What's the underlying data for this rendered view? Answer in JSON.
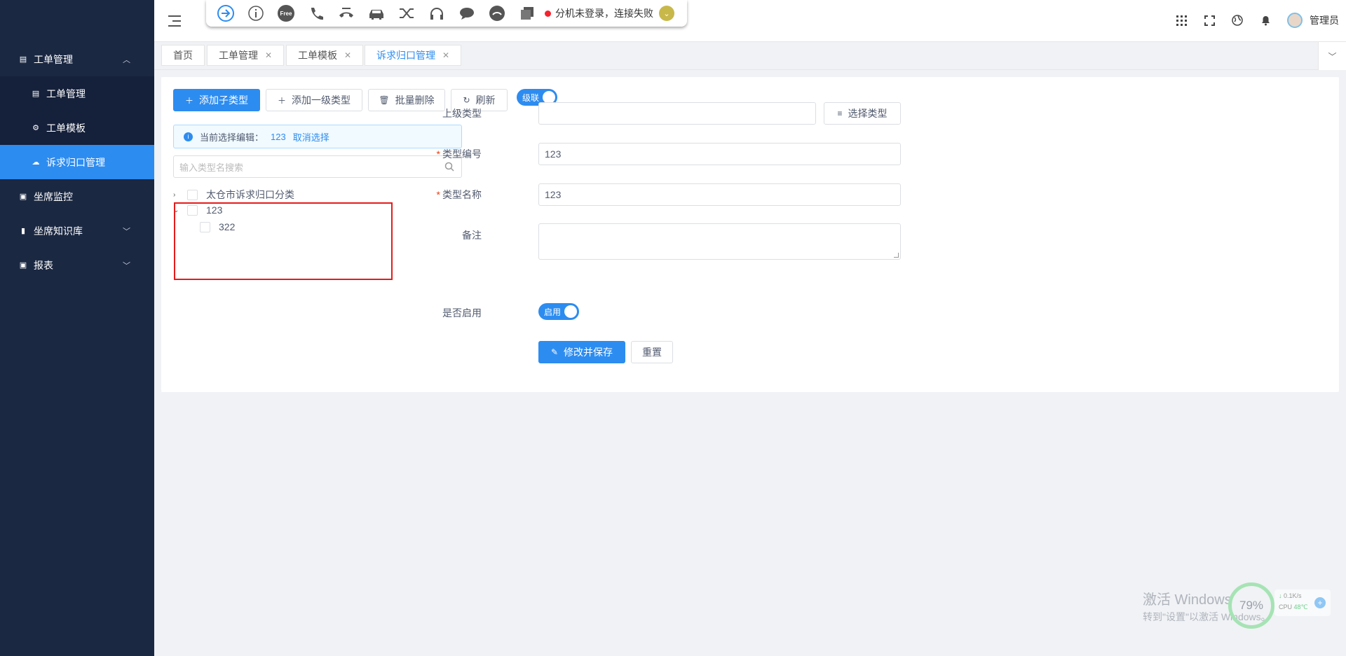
{
  "sidebar": {
    "items": [
      {
        "label": "工单管理",
        "icon": "document-icon",
        "expanded": true
      },
      {
        "label": "工单管理",
        "icon": "document-icon"
      },
      {
        "label": "工单模板",
        "icon": "gear-icon"
      },
      {
        "label": "诉求归口管理",
        "icon": "cloud-icon",
        "active": true
      },
      {
        "label": "坐席监控",
        "icon": "chart-icon"
      },
      {
        "label": "坐席知识库",
        "icon": "book-icon"
      },
      {
        "label": "报表",
        "icon": "chart-icon"
      }
    ]
  },
  "phonebar": {
    "icons": [
      "sign-in-icon",
      "info-icon",
      "free-icon",
      "phone-icon",
      "hangup-icon",
      "car-icon",
      "transfer-icon",
      "headset-icon",
      "chat-icon",
      "hold-icon",
      "copy-icon"
    ],
    "free_label": "Free",
    "status": "分机未登录，连接失败"
  },
  "header": {
    "username": "管理员"
  },
  "tabs": [
    {
      "label": "首页",
      "closable": false
    },
    {
      "label": "工单管理",
      "closable": true
    },
    {
      "label": "工单模板",
      "closable": true
    },
    {
      "label": "诉求归口管理",
      "closable": true,
      "active": true
    }
  ],
  "toolbar": {
    "add_child": "添加子类型",
    "add_top": "添加一级类型",
    "batch_delete": "批量删除",
    "refresh": "刷新",
    "cascade": "级联"
  },
  "alert": {
    "prefix": "当前选择编辑：",
    "selected": "123",
    "cancel": "取消选择"
  },
  "search": {
    "placeholder": "输入类型名搜索"
  },
  "tree": {
    "nodes": [
      {
        "label": "太仓市诉求归口分类",
        "expanded": false
      },
      {
        "label": "123",
        "expanded": true
      },
      {
        "label": "322",
        "child": true
      }
    ]
  },
  "form": {
    "parent_label": "上级类型",
    "parent_value": "",
    "select_type": "选择类型",
    "code_label": "类型编号",
    "code_value": "123",
    "name_label": "类型名称",
    "name_value": "123",
    "remark_label": "备注",
    "remark_value": "",
    "enabled_label": "是否启用",
    "enabled_switch": "启用",
    "save": "修改并保存",
    "reset": "重置"
  },
  "watermark": {
    "title": "激活 Windows",
    "sub": "转到\"设置\"以激活 Windows。",
    "percent": "79%",
    "speed": "0.1K/s",
    "cpu": "CPU",
    "temp": "48℃"
  },
  "colors": {
    "sidebar_bg": "#1b2842",
    "primary": "#2d8cf0",
    "highlight": "#e51b1b"
  }
}
